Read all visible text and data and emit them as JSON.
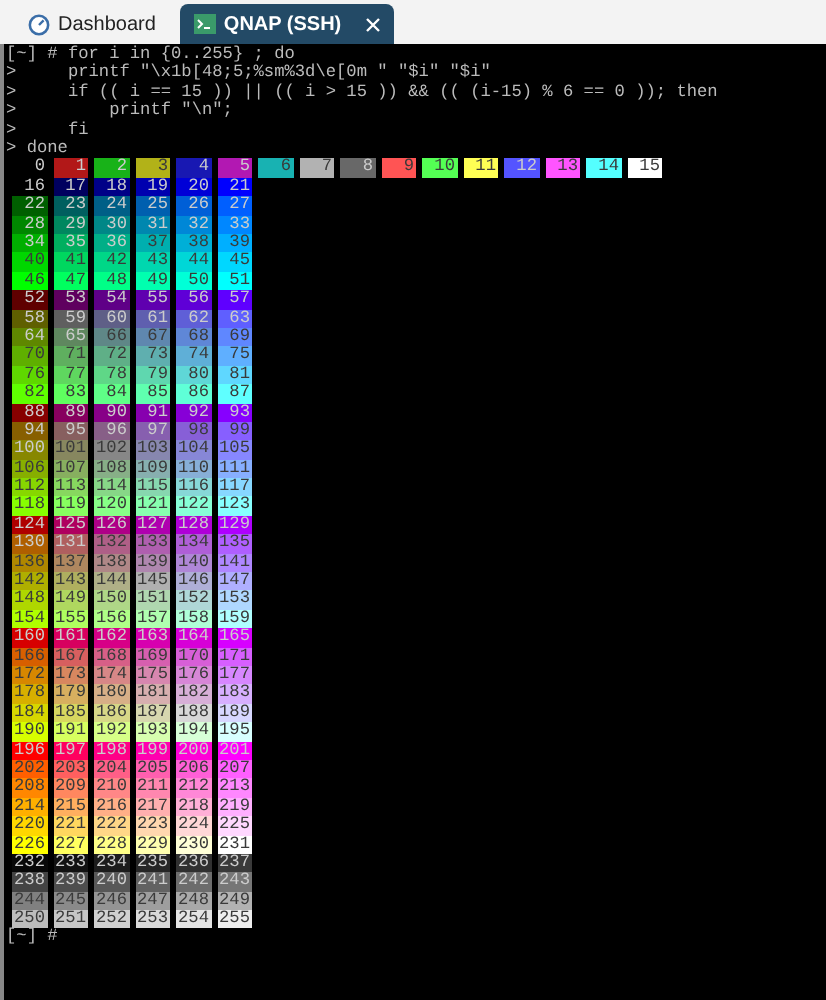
{
  "tabs": [
    {
      "label": "Dashboard",
      "kind": "dashboard",
      "selected": false,
      "closable": false
    },
    {
      "label": "QNAP (SSH)",
      "kind": "terminal",
      "selected": true,
      "closable": true
    }
  ],
  "terminal": {
    "command_lines": [
      "[~] # for i in {0..255} ; do",
      ">     printf \"\\x1b[48;5;%sm%3d\\e[0m \" \"$i\" \"$i\"",
      ">     if (( i == 15 )) || (( i > 15 )) && (( (i-15) % 6 == 0 )); then",
      ">         printf \"\\n\";",
      ">     fi",
      "> done"
    ],
    "rows": [
      {
        "cells": [
          {
            "text": "0",
            "color": "#000000"
          },
          {
            "text": "1",
            "color": "#b21818"
          },
          {
            "text": "2",
            "color": "#18b218"
          },
          {
            "text": "3",
            "color": "#b2b218"
          },
          {
            "text": "4",
            "color": "#1818b2"
          },
          {
            "text": "5",
            "color": "#b218b2"
          },
          {
            "text": "6",
            "color": "#18b2b2"
          },
          {
            "text": "7",
            "color": "#b2b2b2"
          },
          {
            "text": "8",
            "color": "#686868"
          },
          {
            "text": "9",
            "color": "#ff5454"
          },
          {
            "text": "10",
            "color": "#54ff54"
          },
          {
            "text": "11",
            "color": "#ffff54"
          },
          {
            "text": "12",
            "color": "#5454ff"
          },
          {
            "text": "13",
            "color": "#ff54ff"
          },
          {
            "text": "14",
            "color": "#54ffff"
          },
          {
            "text": "15",
            "color": "#ffffff"
          }
        ]
      },
      {
        "cells": [
          {
            "text": "16",
            "color": "#000000"
          },
          {
            "text": "17",
            "color": "#00005f"
          },
          {
            "text": "18",
            "color": "#000087"
          },
          {
            "text": "19",
            "color": "#0000af"
          },
          {
            "text": "20",
            "color": "#0000d7"
          },
          {
            "text": "21",
            "color": "#0000ff"
          }
        ]
      },
      {
        "cells": [
          {
            "text": "22",
            "color": "#005f00"
          },
          {
            "text": "23",
            "color": "#005f5f"
          },
          {
            "text": "24",
            "color": "#005f87"
          },
          {
            "text": "25",
            "color": "#005faf"
          },
          {
            "text": "26",
            "color": "#005fd7"
          },
          {
            "text": "27",
            "color": "#005fff"
          }
        ]
      },
      {
        "cells": [
          {
            "text": "28",
            "color": "#008700"
          },
          {
            "text": "29",
            "color": "#00875f"
          },
          {
            "text": "30",
            "color": "#008787"
          },
          {
            "text": "31",
            "color": "#0087af"
          },
          {
            "text": "32",
            "color": "#0087d7"
          },
          {
            "text": "33",
            "color": "#0087ff"
          }
        ]
      },
      {
        "cells": [
          {
            "text": "34",
            "color": "#00af00"
          },
          {
            "text": "35",
            "color": "#00af5f"
          },
          {
            "text": "36",
            "color": "#00af87"
          },
          {
            "text": "37",
            "color": "#00afaf"
          },
          {
            "text": "38",
            "color": "#00afd7"
          },
          {
            "text": "39",
            "color": "#00afff"
          }
        ]
      },
      {
        "cells": [
          {
            "text": "40",
            "color": "#00d700"
          },
          {
            "text": "41",
            "color": "#00d75f"
          },
          {
            "text": "42",
            "color": "#00d787"
          },
          {
            "text": "43",
            "color": "#00d7af"
          },
          {
            "text": "44",
            "color": "#00d7d7"
          },
          {
            "text": "45",
            "color": "#00d7ff"
          }
        ]
      },
      {
        "cells": [
          {
            "text": "46",
            "color": "#00ff00"
          },
          {
            "text": "47",
            "color": "#00ff5f"
          },
          {
            "text": "48",
            "color": "#00ff87"
          },
          {
            "text": "49",
            "color": "#00ffaf"
          },
          {
            "text": "50",
            "color": "#00ffd7"
          },
          {
            "text": "51",
            "color": "#00ffff"
          }
        ]
      },
      {
        "cells": [
          {
            "text": "52",
            "color": "#5f0000"
          },
          {
            "text": "53",
            "color": "#5f005f"
          },
          {
            "text": "54",
            "color": "#5f0087"
          },
          {
            "text": "55",
            "color": "#5f00af"
          },
          {
            "text": "56",
            "color": "#5f00d7"
          },
          {
            "text": "57",
            "color": "#5f00ff"
          }
        ]
      },
      {
        "cells": [
          {
            "text": "58",
            "color": "#5f5f00"
          },
          {
            "text": "59",
            "color": "#5f5f5f"
          },
          {
            "text": "60",
            "color": "#5f5f87"
          },
          {
            "text": "61",
            "color": "#5f5faf"
          },
          {
            "text": "62",
            "color": "#5f5fd7"
          },
          {
            "text": "63",
            "color": "#5f5fff"
          }
        ]
      },
      {
        "cells": [
          {
            "text": "64",
            "color": "#5f8700"
          },
          {
            "text": "65",
            "color": "#5f875f"
          },
          {
            "text": "66",
            "color": "#5f8787"
          },
          {
            "text": "67",
            "color": "#5f87af"
          },
          {
            "text": "68",
            "color": "#5f87d7"
          },
          {
            "text": "69",
            "color": "#5f87ff"
          }
        ]
      },
      {
        "cells": [
          {
            "text": "70",
            "color": "#5faf00"
          },
          {
            "text": "71",
            "color": "#5faf5f"
          },
          {
            "text": "72",
            "color": "#5faf87"
          },
          {
            "text": "73",
            "color": "#5fafaf"
          },
          {
            "text": "74",
            "color": "#5fafd7"
          },
          {
            "text": "75",
            "color": "#5fafff"
          }
        ]
      },
      {
        "cells": [
          {
            "text": "76",
            "color": "#5fd700"
          },
          {
            "text": "77",
            "color": "#5fd75f"
          },
          {
            "text": "78",
            "color": "#5fd787"
          },
          {
            "text": "79",
            "color": "#5fd7af"
          },
          {
            "text": "80",
            "color": "#5fd7d7"
          },
          {
            "text": "81",
            "color": "#5fd7ff"
          }
        ]
      },
      {
        "cells": [
          {
            "text": "82",
            "color": "#5fff00"
          },
          {
            "text": "83",
            "color": "#5fff5f"
          },
          {
            "text": "84",
            "color": "#5fff87"
          },
          {
            "text": "85",
            "color": "#5fffaf"
          },
          {
            "text": "86",
            "color": "#5fffd7"
          },
          {
            "text": "87",
            "color": "#5fffff"
          }
        ]
      },
      {
        "cells": [
          {
            "text": "88",
            "color": "#870000"
          },
          {
            "text": "89",
            "color": "#87005f"
          },
          {
            "text": "90",
            "color": "#870087"
          },
          {
            "text": "91",
            "color": "#8700af"
          },
          {
            "text": "92",
            "color": "#8700d7"
          },
          {
            "text": "93",
            "color": "#8700ff"
          }
        ]
      },
      {
        "cells": [
          {
            "text": "94",
            "color": "#875f00"
          },
          {
            "text": "95",
            "color": "#875f5f"
          },
          {
            "text": "96",
            "color": "#875f87"
          },
          {
            "text": "97",
            "color": "#875faf"
          },
          {
            "text": "98",
            "color": "#875fd7"
          },
          {
            "text": "99",
            "color": "#875fff"
          }
        ]
      },
      {
        "cells": [
          {
            "text": "100",
            "color": "#878700"
          },
          {
            "text": "101",
            "color": "#87875f"
          },
          {
            "text": "102",
            "color": "#878787"
          },
          {
            "text": "103",
            "color": "#8787af"
          },
          {
            "text": "104",
            "color": "#8787d7"
          },
          {
            "text": "105",
            "color": "#8787ff"
          }
        ]
      },
      {
        "cells": [
          {
            "text": "106",
            "color": "#87af00"
          },
          {
            "text": "107",
            "color": "#87af5f"
          },
          {
            "text": "108",
            "color": "#87af87"
          },
          {
            "text": "109",
            "color": "#87afaf"
          },
          {
            "text": "110",
            "color": "#87afd7"
          },
          {
            "text": "111",
            "color": "#87afff"
          }
        ]
      },
      {
        "cells": [
          {
            "text": "112",
            "color": "#87d700"
          },
          {
            "text": "113",
            "color": "#87d75f"
          },
          {
            "text": "114",
            "color": "#87d787"
          },
          {
            "text": "115",
            "color": "#87d7af"
          },
          {
            "text": "116",
            "color": "#87d7d7"
          },
          {
            "text": "117",
            "color": "#87d7ff"
          }
        ]
      },
      {
        "cells": [
          {
            "text": "118",
            "color": "#87ff00"
          },
          {
            "text": "119",
            "color": "#87ff5f"
          },
          {
            "text": "120",
            "color": "#87ff87"
          },
          {
            "text": "121",
            "color": "#87ffaf"
          },
          {
            "text": "122",
            "color": "#87ffd7"
          },
          {
            "text": "123",
            "color": "#87ffff"
          }
        ]
      },
      {
        "cells": [
          {
            "text": "124",
            "color": "#af0000"
          },
          {
            "text": "125",
            "color": "#af005f"
          },
          {
            "text": "126",
            "color": "#af0087"
          },
          {
            "text": "127",
            "color": "#af00af"
          },
          {
            "text": "128",
            "color": "#af00d7"
          },
          {
            "text": "129",
            "color": "#af00ff"
          }
        ]
      },
      {
        "cells": [
          {
            "text": "130",
            "color": "#af5f00"
          },
          {
            "text": "131",
            "color": "#af5f5f"
          },
          {
            "text": "132",
            "color": "#af5f87"
          },
          {
            "text": "133",
            "color": "#af5faf"
          },
          {
            "text": "134",
            "color": "#af5fd7"
          },
          {
            "text": "135",
            "color": "#af5fff"
          }
        ]
      },
      {
        "cells": [
          {
            "text": "136",
            "color": "#af8700"
          },
          {
            "text": "137",
            "color": "#af875f"
          },
          {
            "text": "138",
            "color": "#af8787"
          },
          {
            "text": "139",
            "color": "#af87af"
          },
          {
            "text": "140",
            "color": "#af87d7"
          },
          {
            "text": "141",
            "color": "#af87ff"
          }
        ]
      },
      {
        "cells": [
          {
            "text": "142",
            "color": "#afaf00"
          },
          {
            "text": "143",
            "color": "#afaf5f"
          },
          {
            "text": "144",
            "color": "#afaf87"
          },
          {
            "text": "145",
            "color": "#afafaf"
          },
          {
            "text": "146",
            "color": "#afafd7"
          },
          {
            "text": "147",
            "color": "#afafff"
          }
        ]
      },
      {
        "cells": [
          {
            "text": "148",
            "color": "#afd700"
          },
          {
            "text": "149",
            "color": "#afd75f"
          },
          {
            "text": "150",
            "color": "#afd787"
          },
          {
            "text": "151",
            "color": "#afd7af"
          },
          {
            "text": "152",
            "color": "#afd7d7"
          },
          {
            "text": "153",
            "color": "#afd7ff"
          }
        ]
      },
      {
        "cells": [
          {
            "text": "154",
            "color": "#afff00"
          },
          {
            "text": "155",
            "color": "#afff5f"
          },
          {
            "text": "156",
            "color": "#afff87"
          },
          {
            "text": "157",
            "color": "#afffaf"
          },
          {
            "text": "158",
            "color": "#afffd7"
          },
          {
            "text": "159",
            "color": "#afffff"
          }
        ]
      },
      {
        "cells": [
          {
            "text": "160",
            "color": "#d70000"
          },
          {
            "text": "161",
            "color": "#d7005f"
          },
          {
            "text": "162",
            "color": "#d70087"
          },
          {
            "text": "163",
            "color": "#d700af"
          },
          {
            "text": "164",
            "color": "#d700d7"
          },
          {
            "text": "165",
            "color": "#d700ff"
          }
        ]
      },
      {
        "cells": [
          {
            "text": "166",
            "color": "#d75f00"
          },
          {
            "text": "167",
            "color": "#d75f5f"
          },
          {
            "text": "168",
            "color": "#d75f87"
          },
          {
            "text": "169",
            "color": "#d75faf"
          },
          {
            "text": "170",
            "color": "#d75fd7"
          },
          {
            "text": "171",
            "color": "#d75fff"
          }
        ]
      },
      {
        "cells": [
          {
            "text": "172",
            "color": "#d78700"
          },
          {
            "text": "173",
            "color": "#d7875f"
          },
          {
            "text": "174",
            "color": "#d78787"
          },
          {
            "text": "175",
            "color": "#d787af"
          },
          {
            "text": "176",
            "color": "#d787d7"
          },
          {
            "text": "177",
            "color": "#d787ff"
          }
        ]
      },
      {
        "cells": [
          {
            "text": "178",
            "color": "#d7af00"
          },
          {
            "text": "179",
            "color": "#d7af5f"
          },
          {
            "text": "180",
            "color": "#d7af87"
          },
          {
            "text": "181",
            "color": "#d7afaf"
          },
          {
            "text": "182",
            "color": "#d7afd7"
          },
          {
            "text": "183",
            "color": "#d7afff"
          }
        ]
      },
      {
        "cells": [
          {
            "text": "184",
            "color": "#d7d700"
          },
          {
            "text": "185",
            "color": "#d7d75f"
          },
          {
            "text": "186",
            "color": "#d7d787"
          },
          {
            "text": "187",
            "color": "#d7d7af"
          },
          {
            "text": "188",
            "color": "#d7d7d7"
          },
          {
            "text": "189",
            "color": "#d7d7ff"
          }
        ]
      },
      {
        "cells": [
          {
            "text": "190",
            "color": "#d7ff00"
          },
          {
            "text": "191",
            "color": "#d7ff5f"
          },
          {
            "text": "192",
            "color": "#d7ff87"
          },
          {
            "text": "193",
            "color": "#d7ffaf"
          },
          {
            "text": "194",
            "color": "#d7ffd7"
          },
          {
            "text": "195",
            "color": "#d7ffff"
          }
        ]
      },
      {
        "cells": [
          {
            "text": "196",
            "color": "#ff0000"
          },
          {
            "text": "197",
            "color": "#ff005f"
          },
          {
            "text": "198",
            "color": "#ff0087"
          },
          {
            "text": "199",
            "color": "#ff00af"
          },
          {
            "text": "200",
            "color": "#ff00d7"
          },
          {
            "text": "201",
            "color": "#ff00ff"
          }
        ]
      },
      {
        "cells": [
          {
            "text": "202",
            "color": "#ff5f00"
          },
          {
            "text": "203",
            "color": "#ff5f5f"
          },
          {
            "text": "204",
            "color": "#ff5f87"
          },
          {
            "text": "205",
            "color": "#ff5faf"
          },
          {
            "text": "206",
            "color": "#ff5fd7"
          },
          {
            "text": "207",
            "color": "#ff5fff"
          }
        ]
      },
      {
        "cells": [
          {
            "text": "208",
            "color": "#ff8700"
          },
          {
            "text": "209",
            "color": "#ff875f"
          },
          {
            "text": "210",
            "color": "#ff8787"
          },
          {
            "text": "211",
            "color": "#ff87af"
          },
          {
            "text": "212",
            "color": "#ff87d7"
          },
          {
            "text": "213",
            "color": "#ff87ff"
          }
        ]
      },
      {
        "cells": [
          {
            "text": "214",
            "color": "#ffaf00"
          },
          {
            "text": "215",
            "color": "#ffaf5f"
          },
          {
            "text": "216",
            "color": "#ffaf87"
          },
          {
            "text": "217",
            "color": "#ffafaf"
          },
          {
            "text": "218",
            "color": "#ffafd7"
          },
          {
            "text": "219",
            "color": "#ffafff"
          }
        ]
      },
      {
        "cells": [
          {
            "text": "220",
            "color": "#ffd700"
          },
          {
            "text": "221",
            "color": "#ffd75f"
          },
          {
            "text": "222",
            "color": "#ffd787"
          },
          {
            "text": "223",
            "color": "#ffd7af"
          },
          {
            "text": "224",
            "color": "#ffd7d7"
          },
          {
            "text": "225",
            "color": "#ffd7ff"
          }
        ]
      },
      {
        "cells": [
          {
            "text": "226",
            "color": "#ffff00"
          },
          {
            "text": "227",
            "color": "#ffff5f"
          },
          {
            "text": "228",
            "color": "#ffff87"
          },
          {
            "text": "229",
            "color": "#ffffaf"
          },
          {
            "text": "230",
            "color": "#ffffd7"
          },
          {
            "text": "231",
            "color": "#ffffff"
          }
        ]
      },
      {
        "cells": [
          {
            "text": "232",
            "color": "#080808"
          },
          {
            "text": "233",
            "color": "#121212"
          },
          {
            "text": "234",
            "color": "#1c1c1c"
          },
          {
            "text": "235",
            "color": "#262626"
          },
          {
            "text": "236",
            "color": "#303030"
          },
          {
            "text": "237",
            "color": "#3a3a3a"
          }
        ]
      },
      {
        "cells": [
          {
            "text": "238",
            "color": "#444444"
          },
          {
            "text": "239",
            "color": "#4e4e4e"
          },
          {
            "text": "240",
            "color": "#585858"
          },
          {
            "text": "241",
            "color": "#626262"
          },
          {
            "text": "242",
            "color": "#6c6c6c"
          },
          {
            "text": "243",
            "color": "#767676"
          }
        ]
      },
      {
        "cells": [
          {
            "text": "244",
            "color": "#808080"
          },
          {
            "text": "245",
            "color": "#8a8a8a"
          },
          {
            "text": "246",
            "color": "#949494"
          },
          {
            "text": "247",
            "color": "#9e9e9e"
          },
          {
            "text": "248",
            "color": "#a8a8a8"
          },
          {
            "text": "249",
            "color": "#b2b2b2"
          }
        ]
      },
      {
        "cells": [
          {
            "text": "250",
            "color": "#bcbcbc"
          },
          {
            "text": "251",
            "color": "#c6c6c6"
          },
          {
            "text": "252",
            "color": "#d0d0d0"
          },
          {
            "text": "253",
            "color": "#dadada"
          },
          {
            "text": "254",
            "color": "#e4e4e4"
          },
          {
            "text": "255",
            "color": "#eeeeee"
          }
        ]
      }
    ],
    "prompt": "[~] #"
  }
}
